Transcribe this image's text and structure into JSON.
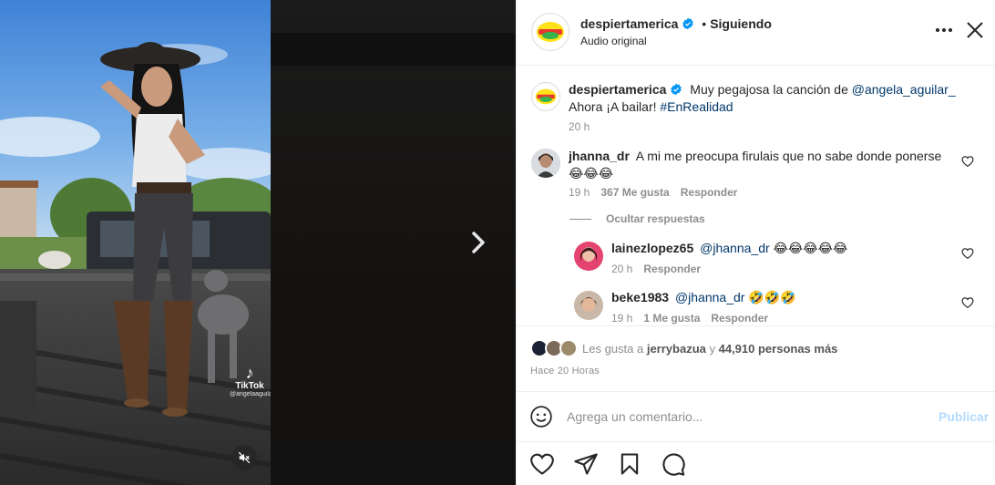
{
  "colors": {
    "link": "#00376b",
    "verified": "#0095f6",
    "muted": "#8e8e8e",
    "publish_disabled": "#b3dbff"
  },
  "video": {
    "watermark_label": "TikTok",
    "watermark_handle": "@angelaaguilar_",
    "mute_icon": "speaker-muted-icon",
    "next_icon": "chevron-right-icon"
  },
  "header": {
    "username": "despiertamerica",
    "follow_status": "Siguiendo",
    "audio_label": "Audio original",
    "more_icon": "more-horizontal-icon",
    "close_icon": "close-icon"
  },
  "caption": {
    "username": "despiertamerica",
    "text_before": "Muy pegajosa la canción de ",
    "mention": "@angela_aguilar_",
    "text_after": "Ahora ¡A bailar! ",
    "hashtag": "#EnRealidad",
    "time": "20 h"
  },
  "comments": [
    {
      "username": "jhanna_dr",
      "text": "A mi me preocupa firulais que no sabe donde ponerse",
      "emojis": "😂😂😂",
      "time": "19 h",
      "likes": "367 Me gusta",
      "reply_label": "Responder",
      "hide_replies": "Ocultar respuestas",
      "replies": [
        {
          "username": "lainezlopez65",
          "mention": "@jhanna_dr",
          "emojis": "😂😂😂😂😂",
          "time": "20 h",
          "likes": "",
          "reply_label": "Responder"
        },
        {
          "username": "beke1983",
          "mention": "@jhanna_dr",
          "emojis": "🤣🤣🤣",
          "time": "19 h",
          "likes": "1 Me gusta",
          "reply_label": "Responder"
        }
      ]
    }
  ],
  "likes": {
    "prefix": "Les gusta a ",
    "first_user": "jerrybazua",
    "connector": " y ",
    "others": "44,910 personas más",
    "posted": "Hace 20 Horas"
  },
  "comment_box": {
    "placeholder": "Agrega un comentario...",
    "publish_label": "Publicar",
    "emoji_icon": "emoji-smile-icon"
  },
  "action_icons": [
    "heart-icon",
    "share-icon",
    "bookmark-icon",
    "comment-icon"
  ]
}
